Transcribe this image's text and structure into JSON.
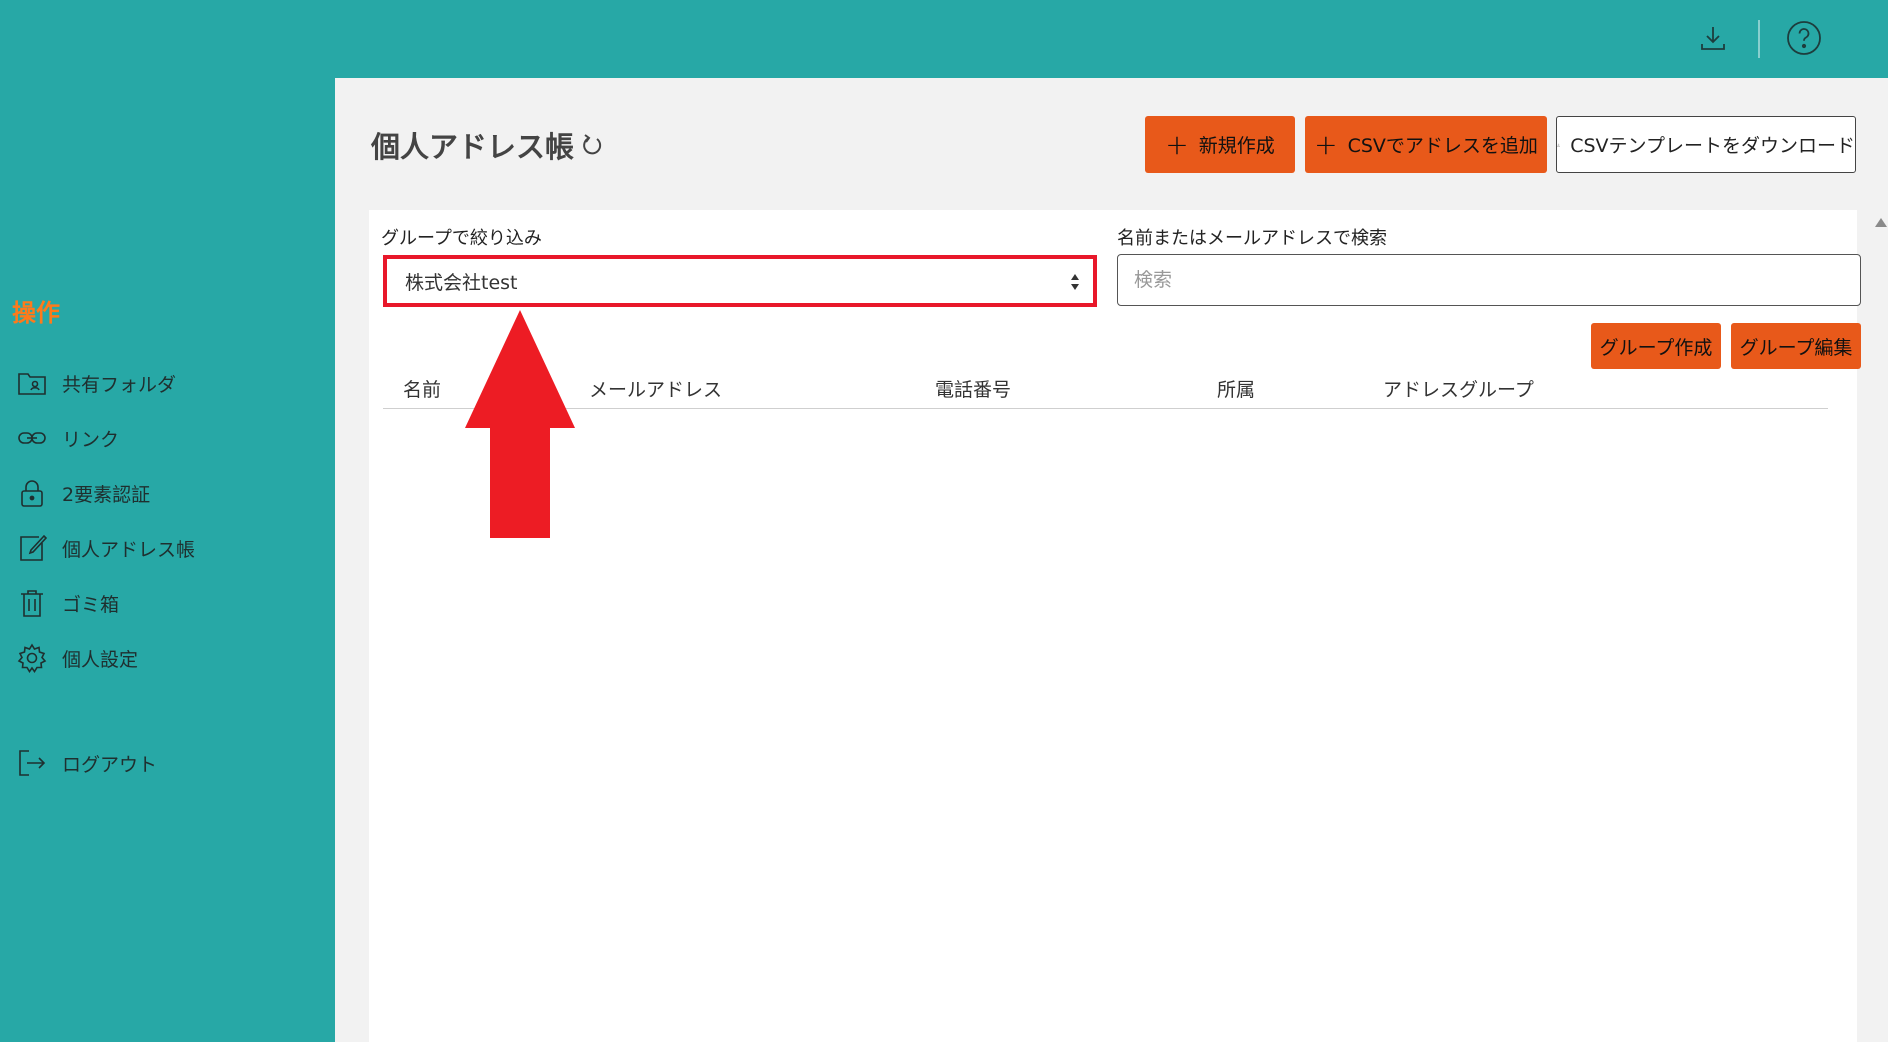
{
  "header": {
    "download_icon": "download-icon",
    "help_icon": "help-circle-icon"
  },
  "sidebar": {
    "heading": "操作",
    "items": [
      {
        "label": "共有フォルダ",
        "icon": "shared-folder-icon"
      },
      {
        "label": "リンク",
        "icon": "link-icon"
      },
      {
        "label": "2要素認証",
        "icon": "lock-icon"
      },
      {
        "label": "個人アドレス帳",
        "icon": "edit-icon"
      },
      {
        "label": "ゴミ箱",
        "icon": "trash-icon"
      },
      {
        "label": "個人設定",
        "icon": "gear-icon"
      },
      {
        "label": "ログアウト",
        "icon": "logout-icon"
      }
    ]
  },
  "main": {
    "title": "個人アドレス帳",
    "actions": {
      "new": "新規作成",
      "csv_add": "CSVでアドレスを追加",
      "csv_template": "CSVテンプレートをダウンロード"
    },
    "filter": {
      "label": "グループで絞り込み",
      "selected": "株式会社test"
    },
    "search": {
      "label": "名前またはメールアドレスで検索",
      "placeholder": "検索",
      "value": ""
    },
    "group_buttons": {
      "create": "グループ作成",
      "edit": "グループ編集"
    },
    "table": {
      "columns": [
        "名前",
        "メールアドレス",
        "電話番号",
        "所属",
        "アドレスグループ"
      ],
      "rows": []
    }
  },
  "colors": {
    "brand_teal": "#27a8a6",
    "accent_orange": "#e8591a",
    "highlight_red": "#e8182a"
  }
}
